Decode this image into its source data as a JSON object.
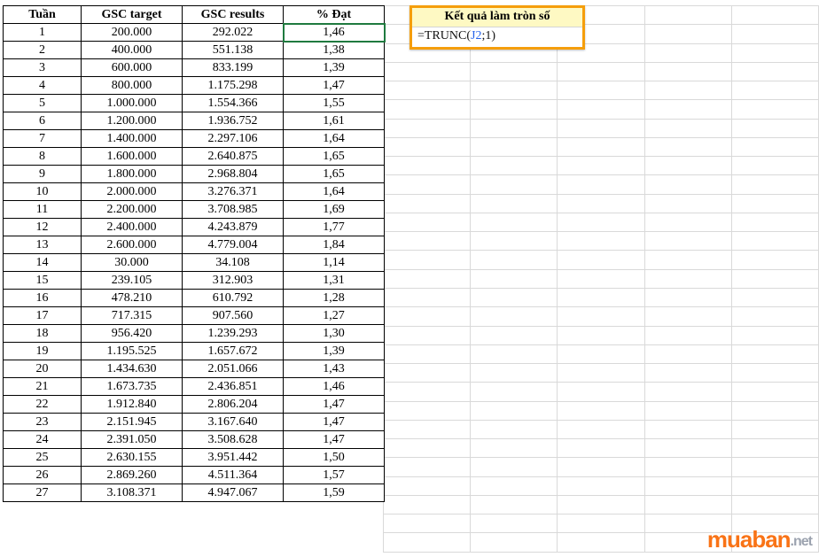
{
  "headers": {
    "tuan": "Tuần",
    "target": "GSC target",
    "results": "GSC results",
    "dat": "% Đạt",
    "round": "Kết quả làm tròn số"
  },
  "formula": {
    "prefix": "=TRUNC(",
    "ref": "J2",
    "suffix": ";1)"
  },
  "rows": [
    {
      "tuan": "1",
      "target": "200.000",
      "results": "292.022",
      "dat": "1,46"
    },
    {
      "tuan": "2",
      "target": "400.000",
      "results": "551.138",
      "dat": "1,38"
    },
    {
      "tuan": "3",
      "target": "600.000",
      "results": "833.199",
      "dat": "1,39"
    },
    {
      "tuan": "4",
      "target": "800.000",
      "results": "1.175.298",
      "dat": "1,47"
    },
    {
      "tuan": "5",
      "target": "1.000.000",
      "results": "1.554.366",
      "dat": "1,55"
    },
    {
      "tuan": "6",
      "target": "1.200.000",
      "results": "1.936.752",
      "dat": "1,61"
    },
    {
      "tuan": "7",
      "target": "1.400.000",
      "results": "2.297.106",
      "dat": "1,64"
    },
    {
      "tuan": "8",
      "target": "1.600.000",
      "results": "2.640.875",
      "dat": "1,65"
    },
    {
      "tuan": "9",
      "target": "1.800.000",
      "results": "2.968.804",
      "dat": "1,65"
    },
    {
      "tuan": "10",
      "target": "2.000.000",
      "results": "3.276.371",
      "dat": "1,64"
    },
    {
      "tuan": "11",
      "target": "2.200.000",
      "results": "3.708.985",
      "dat": "1,69"
    },
    {
      "tuan": "12",
      "target": "2.400.000",
      "results": "4.243.879",
      "dat": "1,77"
    },
    {
      "tuan": "13",
      "target": "2.600.000",
      "results": "4.779.004",
      "dat": "1,84"
    },
    {
      "tuan": "14",
      "target": "30.000",
      "results": "34.108",
      "dat": "1,14"
    },
    {
      "tuan": "15",
      "target": "239.105",
      "results": "312.903",
      "dat": "1,31"
    },
    {
      "tuan": "16",
      "target": "478.210",
      "results": "610.792",
      "dat": "1,28"
    },
    {
      "tuan": "17",
      "target": "717.315",
      "results": "907.560",
      "dat": "1,27"
    },
    {
      "tuan": "18",
      "target": "956.420",
      "results": "1.239.293",
      "dat": "1,30"
    },
    {
      "tuan": "19",
      "target": "1.195.525",
      "results": "1.657.672",
      "dat": "1,39"
    },
    {
      "tuan": "20",
      "target": "1.434.630",
      "results": "2.051.066",
      "dat": "1,43"
    },
    {
      "tuan": "21",
      "target": "1.673.735",
      "results": "2.436.851",
      "dat": "1,46"
    },
    {
      "tuan": "22",
      "target": "1.912.840",
      "results": "2.806.204",
      "dat": "1,47"
    },
    {
      "tuan": "23",
      "target": "2.151.945",
      "results": "3.167.640",
      "dat": "1,47"
    },
    {
      "tuan": "24",
      "target": "2.391.050",
      "results": "3.508.628",
      "dat": "1,47"
    },
    {
      "tuan": "25",
      "target": "2.630.155",
      "results": "3.951.442",
      "dat": "1,50"
    },
    {
      "tuan": "26",
      "target": "2.869.260",
      "results": "4.511.364",
      "dat": "1,57"
    },
    {
      "tuan": "27",
      "target": "3.108.371",
      "results": "4.947.067",
      "dat": "1,59"
    }
  ],
  "watermark": {
    "brand": "muaban",
    "suffix": ".net"
  }
}
